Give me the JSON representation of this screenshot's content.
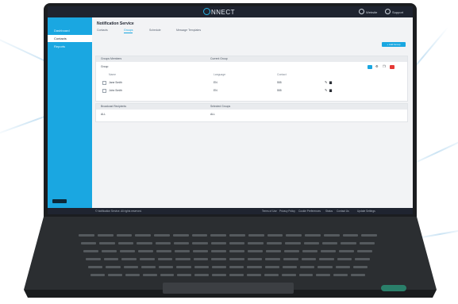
{
  "app": {
    "logo_text": "NNECT",
    "header_right": [
      "Website",
      "Support"
    ],
    "page_title": "Notification Service",
    "tabs": [
      "Contacts",
      "Groups",
      "Schedule",
      "Message Templates"
    ],
    "active_tab": 1,
    "add_button": "+ Add Group",
    "sidebar": {
      "items": [
        "Dashboard",
        "Contacts",
        "Reports"
      ],
      "active_item": 1
    },
    "panel1": {
      "header": [
        "Groups Members",
        "Current Group"
      ],
      "group_name": "Group",
      "columns": [
        "Name",
        "Language",
        "Contact"
      ],
      "rows": [
        {
          "name": "Jane Smith",
          "language": "EN",
          "contact": "555"
        },
        {
          "name": "John Smith",
          "language": "EN",
          "contact": "555"
        }
      ]
    },
    "panel2": {
      "header": [
        "Broadcast Recipients",
        "Selected Groups"
      ],
      "row": [
        "ALL",
        "ALL"
      ]
    },
    "footer_left": "© Notification Service. All rights reserved.",
    "footer_links": [
      "Terms of Use",
      "Privacy Policy",
      "Cookie Preferences",
      "Status",
      "Contact Us",
      "Update Settings"
    ],
    "colors": {
      "accent": "#1aa7e1",
      "topbar": "#1f2430",
      "danger": "#e53935",
      "laptop": "#1b1d20"
    }
  }
}
